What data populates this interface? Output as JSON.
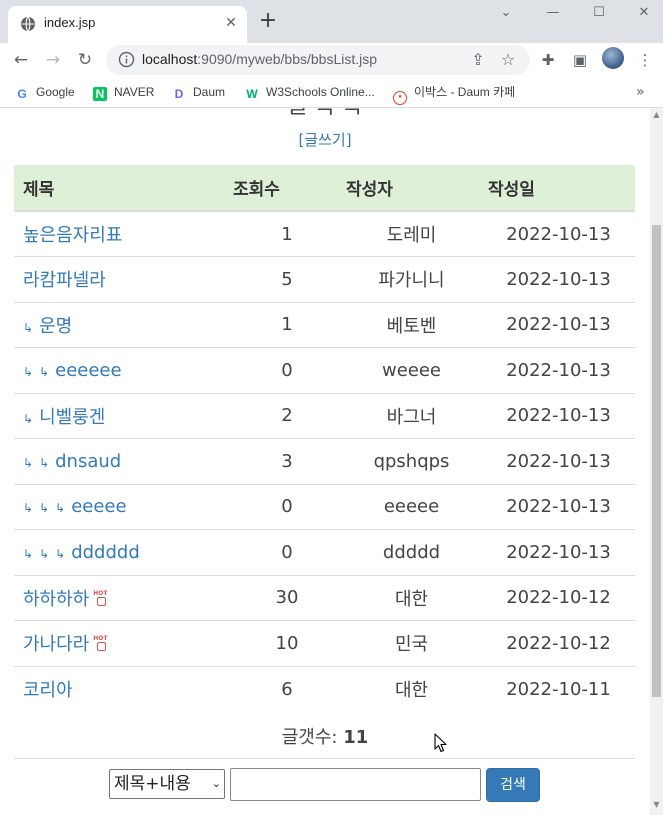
{
  "browser": {
    "tab_title": "index.jsp",
    "tab_close": "✕",
    "new_tab": "+",
    "window_controls": [
      "⌄",
      "—",
      "☐",
      "✕"
    ],
    "url_host": "localhost",
    "url_rest": ":9090/myweb/bbs/bbsList.jsp",
    "bookmarks": [
      {
        "label": "Google",
        "icon": "google-icon",
        "color": "#4285f4"
      },
      {
        "label": "NAVER",
        "icon": "naver-icon",
        "color": "#03c75a"
      },
      {
        "label": "Daum",
        "icon": "daum-icon",
        "color": "#7b5cf0"
      },
      {
        "label": "W3Schools Online...",
        "icon": "w3schools-icon",
        "color": "#04aa6d"
      },
      {
        "label": "이박스 - Daum 카페",
        "icon": "daum-cafe-icon",
        "color": "#e03c31"
      }
    ],
    "bookmarks_more": "»"
  },
  "page": {
    "title": "글 목 록",
    "write_link": "[글쓰기]",
    "headers": {
      "title": "제목",
      "hits": "조회수",
      "writer": "작성자",
      "date": "작성일"
    },
    "rows": [
      {
        "title": "높은음자리표",
        "depth": 0,
        "hits": "1",
        "writer": "도레미",
        "date": "2022-10-13",
        "hot": false
      },
      {
        "title": "라캄파넬라",
        "depth": 0,
        "hits": "5",
        "writer": "파가니니",
        "date": "2022-10-13",
        "hot": false
      },
      {
        "title": "운명",
        "depth": 1,
        "hits": "1",
        "writer": "베토벤",
        "date": "2022-10-13",
        "hot": false
      },
      {
        "title": "eeeeee",
        "depth": 2,
        "hits": "0",
        "writer": "weeee",
        "date": "2022-10-13",
        "hot": false
      },
      {
        "title": "니벨룽겐",
        "depth": 1,
        "hits": "2",
        "writer": "바그너",
        "date": "2022-10-13",
        "hot": false
      },
      {
        "title": "dnsaud",
        "depth": 2,
        "hits": "3",
        "writer": "qpshqps",
        "date": "2022-10-13",
        "hot": false
      },
      {
        "title": "eeeee",
        "depth": 3,
        "hits": "0",
        "writer": "eeeee",
        "date": "2022-10-13",
        "hot": false
      },
      {
        "title": "dddddd",
        "depth": 3,
        "hits": "0",
        "writer": "ddddd",
        "date": "2022-10-13",
        "hot": false
      },
      {
        "title": "하하하하",
        "depth": 0,
        "hits": "30",
        "writer": "대한",
        "date": "2022-10-12",
        "hot": true
      },
      {
        "title": "가나다라",
        "depth": 0,
        "hits": "10",
        "writer": "민국",
        "date": "2022-10-12",
        "hot": true
      },
      {
        "title": "코리아",
        "depth": 0,
        "hits": "6",
        "writer": "대한",
        "date": "2022-10-11",
        "hot": false
      }
    ],
    "count_label": "글갯수: ",
    "count_value": "11",
    "search": {
      "select_value": "제목+내용",
      "input_value": "",
      "button_label": "검색"
    },
    "reply_arrow": "↳",
    "hot_badge": "HOT"
  }
}
